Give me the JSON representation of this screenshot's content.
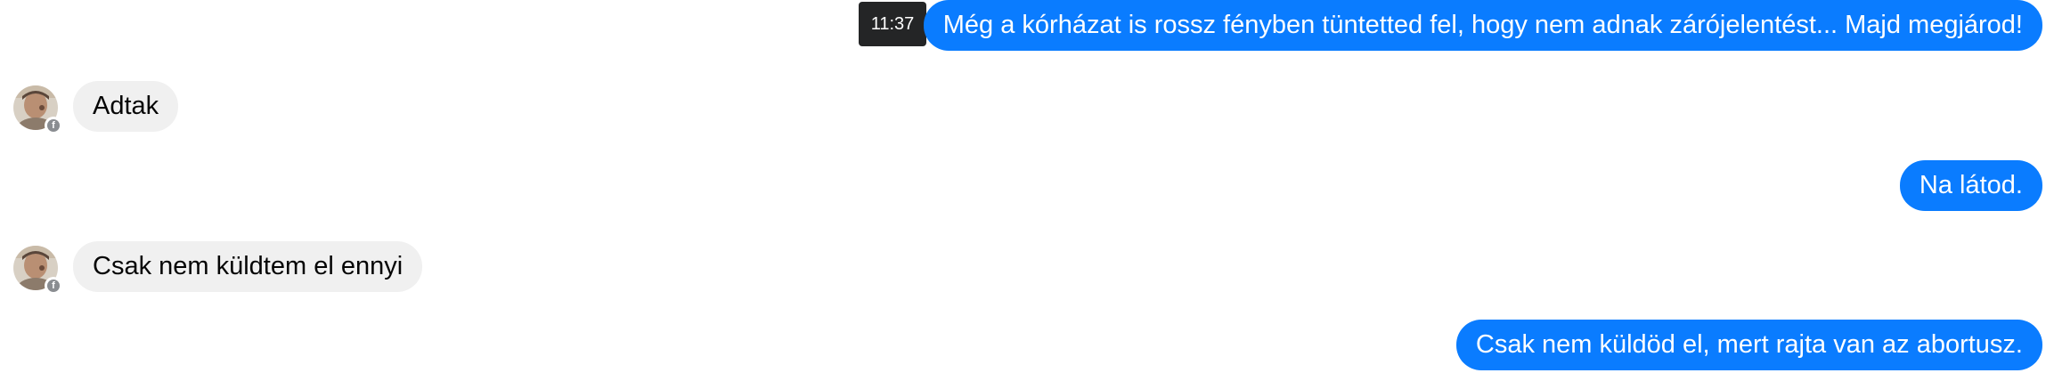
{
  "messages": [
    {
      "direction": "outgoing",
      "text": "Még a kórházat is rossz fényben tüntetted fel, hogy nem adnak zárójelentést... Majd megjárod!",
      "tooltip_time": "11:37"
    },
    {
      "direction": "incoming",
      "text": "Adtak"
    },
    {
      "direction": "outgoing",
      "text": "Na látod."
    },
    {
      "direction": "incoming",
      "text": "Csak nem küldtem el ennyi"
    },
    {
      "direction": "outgoing",
      "text": "Csak nem küldöd el, mert rajta van az abortusz."
    }
  ],
  "icons": {
    "avatar": "contact-avatar",
    "badge": "facebook-icon"
  },
  "colors": {
    "outgoing_bubble": "#0a7cff",
    "incoming_bubble": "#f0f0f0",
    "tooltip_bg": "#242526",
    "badge": "#8a8d91"
  }
}
